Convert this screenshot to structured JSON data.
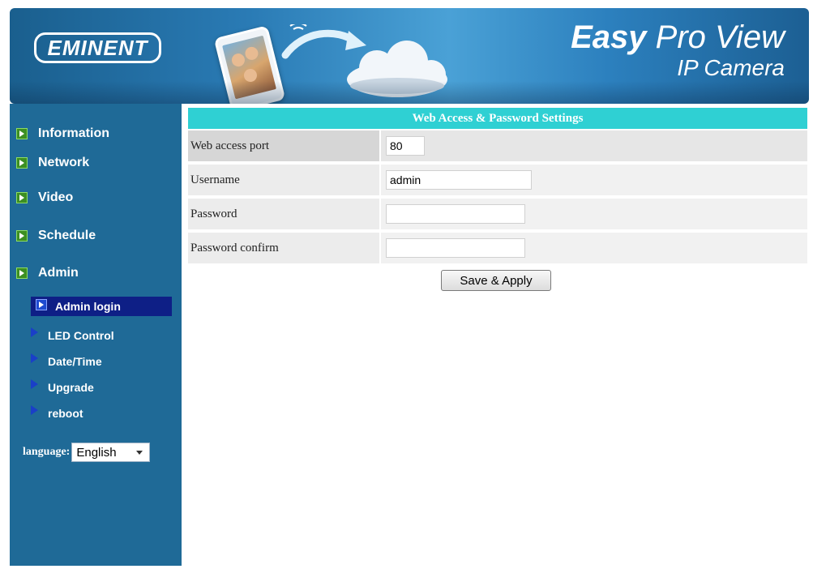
{
  "header": {
    "logo_text": "EMINENT",
    "brand_line1_bold": "Easy",
    "brand_line1_rest": " Pro View",
    "brand_line2": "IP Camera"
  },
  "sidebar": {
    "items": [
      {
        "label": "Information"
      },
      {
        "label": "Network"
      },
      {
        "label": "Video"
      },
      {
        "label": "Schedule"
      },
      {
        "label": "Admin"
      }
    ],
    "sub_items": [
      {
        "label": "Admin login",
        "active": true
      },
      {
        "label": "LED Control"
      },
      {
        "label": "Date/Time"
      },
      {
        "label": "Upgrade"
      },
      {
        "label": "reboot"
      }
    ],
    "language_label": "language:",
    "language_value": "English"
  },
  "form": {
    "title": "Web Access & Password Settings",
    "rows": [
      {
        "label": "Web access port",
        "value": "80"
      },
      {
        "label": "Username",
        "value": "admin"
      },
      {
        "label": "Password",
        "value": ""
      },
      {
        "label": "Password confirm",
        "value": ""
      }
    ],
    "save_label": "Save & Apply"
  },
  "colors": {
    "sidebar_bg": "#1f6a97",
    "header_bar": "#2fd0d3",
    "active_sub_bg": "#0e1f86"
  }
}
